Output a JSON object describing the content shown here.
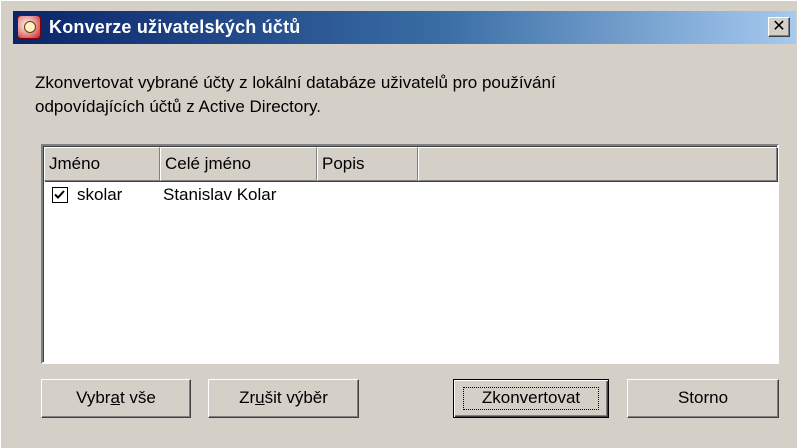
{
  "window": {
    "title": "Konverze uživatelských účtů",
    "close_symbol": "✕"
  },
  "description": {
    "line1": "Zkonvertovat vybrané účty z lokální databáze uživatelů pro používání",
    "line2": "odpovídajících účtů z Active Directory."
  },
  "list": {
    "columns": [
      "Jméno",
      "Celé jméno",
      "Popis",
      ""
    ],
    "rows": [
      {
        "checked": true,
        "jmeno": "skolar",
        "cele_jmeno": "Stanislav Kolar",
        "popis": ""
      }
    ]
  },
  "buttons": {
    "select_all": {
      "pre": "Vybr",
      "accel": "a",
      "post": "t vše"
    },
    "deselect": {
      "pre": "Zr",
      "accel": "u",
      "post": "šit výběr"
    },
    "convert": "Zkonvertovat",
    "cancel": "Storno"
  },
  "colors": {
    "titlebar_start": "#0a246a",
    "titlebar_end": "#a6caf0",
    "dialog_bg": "#d4d0c8"
  },
  "icons": {
    "title": "users-convert-icon",
    "close": "close-icon",
    "checkbox": "checkmark-icon"
  }
}
